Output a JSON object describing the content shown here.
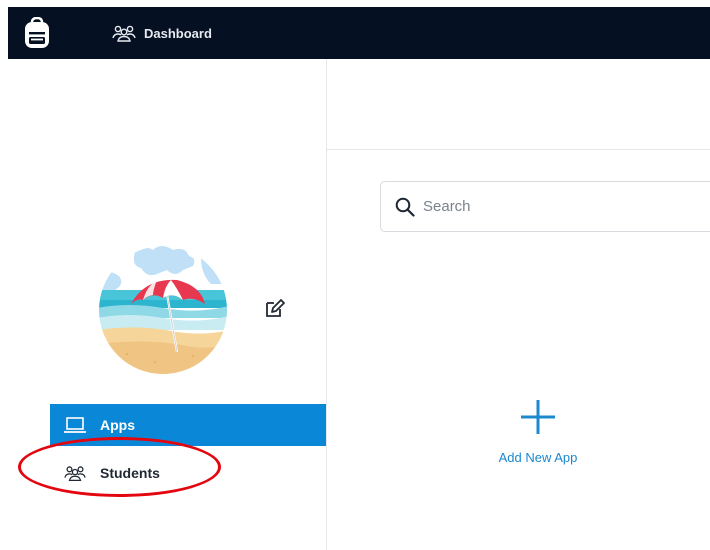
{
  "topbar": {
    "logo_icon": "backpack-icon",
    "nav": {
      "label": "Dashboard",
      "icon": "people-group-icon"
    },
    "background": "#061023"
  },
  "sidebar": {
    "avatar": "beach-umbrella-avatar",
    "edit_icon": "edit-pencil-icon",
    "items": [
      {
        "label": "Apps",
        "icon": "laptop-icon",
        "active": true
      },
      {
        "label": "Students",
        "icon": "people-group-icon",
        "active": false
      }
    ],
    "active_color": "#0b87d8"
  },
  "main": {
    "search": {
      "placeholder": "Search",
      "value": "",
      "icon": "search-icon"
    },
    "add_app": {
      "label": "Add New App",
      "icon": "plus-icon"
    },
    "accent_color": "#1b88cf"
  },
  "annotation": {
    "color": "#e3060f",
    "target": "Students"
  }
}
